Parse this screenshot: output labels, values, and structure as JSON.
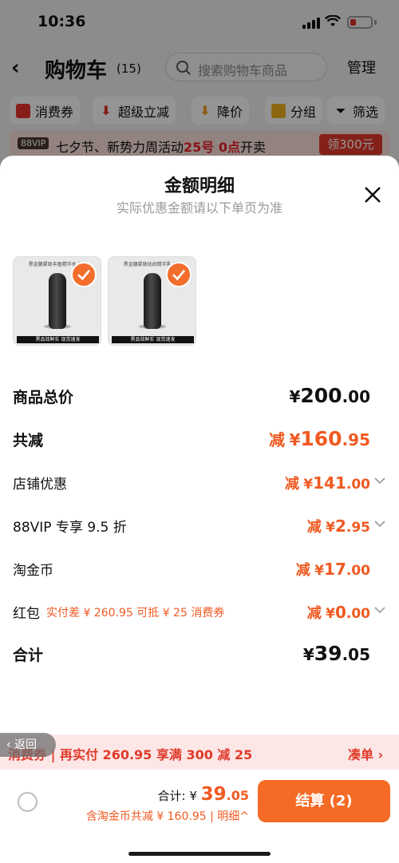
{
  "status_bar": {
    "time": "10:36"
  },
  "nav": {
    "title": "购物车",
    "count": "(15)",
    "search_placeholder": "搜索购物车商品",
    "manage": "管理"
  },
  "filters": [
    {
      "label": "消费券",
      "icon": "coupon-icon"
    },
    {
      "label": "超级立减",
      "icon": "down-arrow-icon"
    },
    {
      "label": "降价",
      "icon": "price-drop-icon"
    },
    {
      "label": "分组",
      "icon": "folder-icon"
    },
    {
      "label": "筛选",
      "icon": "filter-icon"
    }
  ],
  "promo": {
    "vip": "88VIP",
    "text_a": "七夕节、新势力周活动",
    "text_b": "25号 0点",
    "text_c": "开卖",
    "button": "领300元"
  },
  "sheet": {
    "title": "金额明细",
    "subtitle": "实际优惠金额请以下单页为准",
    "products": [
      {
        "caption": "黑金腰紧致丰盈精华水 1...",
        "strip": "黑品效鲜实 现货速发"
      },
      {
        "caption": "黑金腰紧致抚纹精华乳 1...",
        "strip": "黑品效鲜实 现货速发"
      }
    ],
    "rows": {
      "goods_total": {
        "label": "商品总价",
        "symbol": "¥",
        "int": "200",
        "dec": ".00"
      },
      "total_reduce": {
        "label": "共减",
        "prefix": "减",
        "symbol": "¥",
        "int": "160",
        "dec": ".95"
      },
      "shop_discount": {
        "label": "店铺优惠",
        "prefix": "减",
        "symbol": "¥",
        "int": "141",
        "dec": ".00"
      },
      "vip_discount": {
        "label": "88VIP 专享 9.5 折",
        "prefix": "减",
        "symbol": "¥",
        "int": "2",
        "dec": ".95"
      },
      "taojinbi": {
        "label": "淘金币",
        "prefix": "减",
        "symbol": "¥",
        "int": "17",
        "dec": ".00"
      },
      "hongbao": {
        "label": "红包",
        "note": "实付差 ¥ 260.95 可抵 ¥ 25 消费券",
        "prefix": "减",
        "symbol": "¥",
        "int": "0",
        "dec": ".00"
      },
      "sum": {
        "label": "合计",
        "symbol": "¥",
        "int": "39",
        "dec": ".05"
      }
    }
  },
  "notice": {
    "text": "消费券 | 再实付 260.95 享满 300 减 25",
    "link": "凑单 ›",
    "return": "‹ 返回"
  },
  "footer": {
    "total_label": "合计: ¥ ",
    "total_int": "39",
    "total_dec": ".05",
    "saving": "含淘金币共减 ¥ 160.95 | ",
    "detail": "明细^",
    "checkout": "结算 (2)"
  },
  "colors": {
    "accent": "#f05a22",
    "checkout": "#f56a24",
    "notice_bg": "#fde6e6",
    "notice_text": "#e03a2a"
  }
}
